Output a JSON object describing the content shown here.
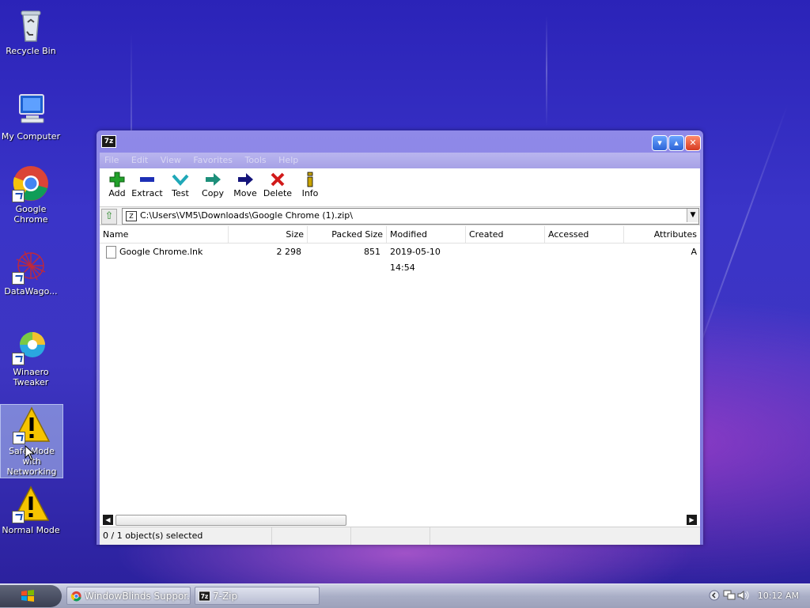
{
  "desktop": {
    "icons": [
      {
        "label": "Recycle Bin"
      },
      {
        "label": "My Computer"
      },
      {
        "label": "Google Chrome"
      },
      {
        "label": "DataWago..."
      },
      {
        "label": "Winaero Tweaker"
      },
      {
        "label": "Safe Mode with Networking"
      },
      {
        "label": "Normal Mode"
      }
    ]
  },
  "window": {
    "icon_text": "7z",
    "menu": [
      "File",
      "Edit",
      "View",
      "Favorites",
      "Tools",
      "Help"
    ],
    "toolbar": [
      {
        "label": "Add",
        "icon": "plus-icon",
        "color": "#21a12a"
      },
      {
        "label": "Extract",
        "icon": "minus-icon",
        "color": "#1d2fb5"
      },
      {
        "label": "Test",
        "icon": "check-icon",
        "color": "#1fa8b8"
      },
      {
        "label": "Copy",
        "icon": "copy-arrow-icon",
        "color": "#1d8f7a"
      },
      {
        "label": "Move",
        "icon": "move-arrow-icon",
        "color": "#14147a"
      },
      {
        "label": "Delete",
        "icon": "delete-x-icon",
        "color": "#d11a1a"
      },
      {
        "label": "Info",
        "icon": "info-icon",
        "color": "#c9a400"
      }
    ],
    "address": "C:\\Users\\VM5\\Downloads\\Google Chrome (1).zip\\",
    "columns": [
      "Name",
      "Size",
      "Packed Size",
      "Modified",
      "Created",
      "Accessed",
      "Attributes"
    ],
    "rows": [
      {
        "name": "Google Chrome.lnk",
        "size": "2 298",
        "packed": "851",
        "modified": "2019-05-10 14:54",
        "created": "",
        "accessed": "",
        "attributes": "A"
      }
    ],
    "status": "0 / 1 object(s) selected"
  },
  "taskbar": {
    "tasks": [
      {
        "label": "WindowBlinds Suppor..."
      },
      {
        "label": "7-Zip"
      }
    ],
    "time": "10:12 AM"
  }
}
